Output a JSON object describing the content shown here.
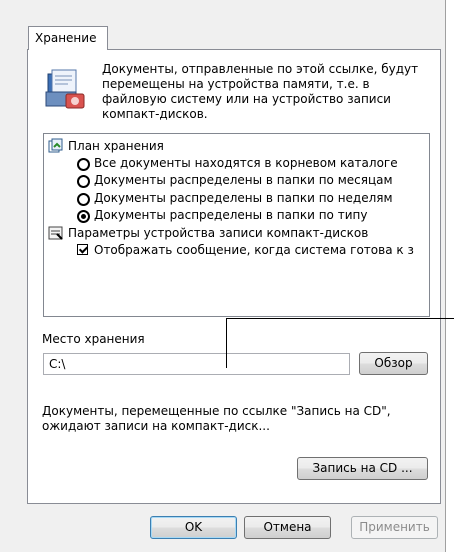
{
  "tab": {
    "label": "Хранение"
  },
  "description": "Документы, отправленные по этой ссылке, будут перемещены на устройства памяти, т.е. в файловую систему или на устройство записи компакт-дисков.",
  "options": {
    "storage_plan_header": "План хранения",
    "radios": [
      {
        "label": "Все документы находятся в корневом каталоге",
        "selected": false
      },
      {
        "label": "Документы распределены в папки по месяцам",
        "selected": false
      },
      {
        "label": "Документы распределены в папки по неделям",
        "selected": false
      },
      {
        "label": "Документы распределены в папки по типу",
        "selected": true
      }
    ],
    "cd_header": "Параметры устройства записи компакт-дисков",
    "checkbox_label": "Отображать сообщение, когда система готова к з",
    "checkbox_checked": true
  },
  "location": {
    "label": "Место хранения",
    "value": "C:\\",
    "browse_label": "Обзор"
  },
  "cd_info": "Документы, перемещенные по ссылке \"Запись на CD\", ожидают записи на компакт-диск...",
  "burn_button": "Запись на CD ...",
  "footer": {
    "ok": "OK",
    "cancel": "Отмена",
    "apply": "Применить"
  }
}
